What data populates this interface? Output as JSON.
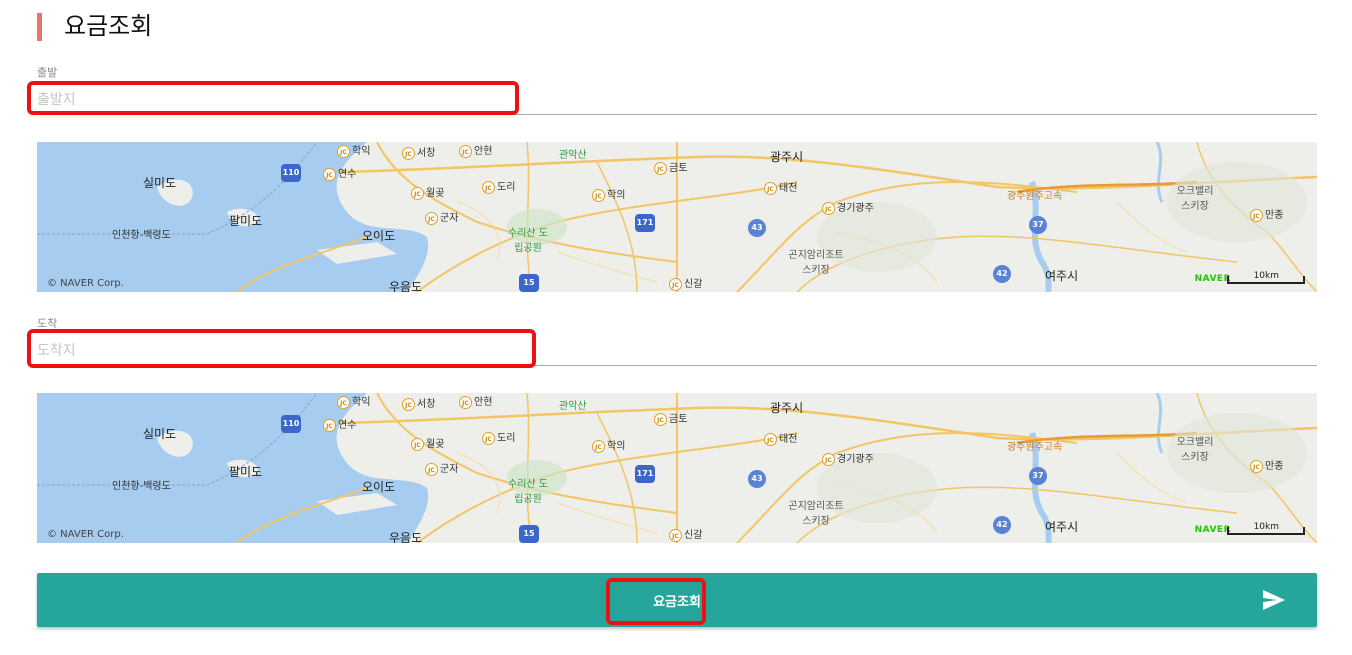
{
  "page": {
    "title": "요금조회"
  },
  "departure": {
    "label": "출발",
    "placeholder": "출발지"
  },
  "arrival": {
    "label": "도착",
    "placeholder": "도착지"
  },
  "map": {
    "copyright": "© NAVER Corp.",
    "brand": "NAVER",
    "scale": "10km",
    "places": {
      "silmido": "실미도",
      "palmido": "팔미도",
      "incheon_port": "인천항-백령도",
      "oido": "오이도",
      "ueumdo": "우음도",
      "suri_park": "수리산 도립공원",
      "gwanaksan": "관악산",
      "gwangju": "광주시",
      "yeoju": "여주시",
      "gonjiam": "곤지암리조트 스키장",
      "oak_valley": "오크밸리 스키장",
      "gwangju_wonju_exp": "광주원주고속"
    },
    "junctions": {
      "hakik": "학익",
      "seochang": "서창",
      "anhyeon": "안현",
      "yeonsu": "연수",
      "wolgot": "월곶",
      "dori": "도리",
      "hakui": "학의",
      "gunja": "군자",
      "geumto": "금토",
      "taejeon": "태전",
      "gyeonggi_gwangju": "경기광주",
      "manjong": "만종",
      "singal": "신갈"
    },
    "routes": {
      "r110": "110",
      "r171": "171",
      "r15": "15",
      "r43": "43",
      "r37": "37",
      "r42": "42"
    }
  },
  "submit": {
    "label": "요금조회",
    "icon": "send-icon"
  },
  "colors": {
    "accent": "#26a69a",
    "title_bar": "#e8736f",
    "highlight": "#ee1111"
  }
}
